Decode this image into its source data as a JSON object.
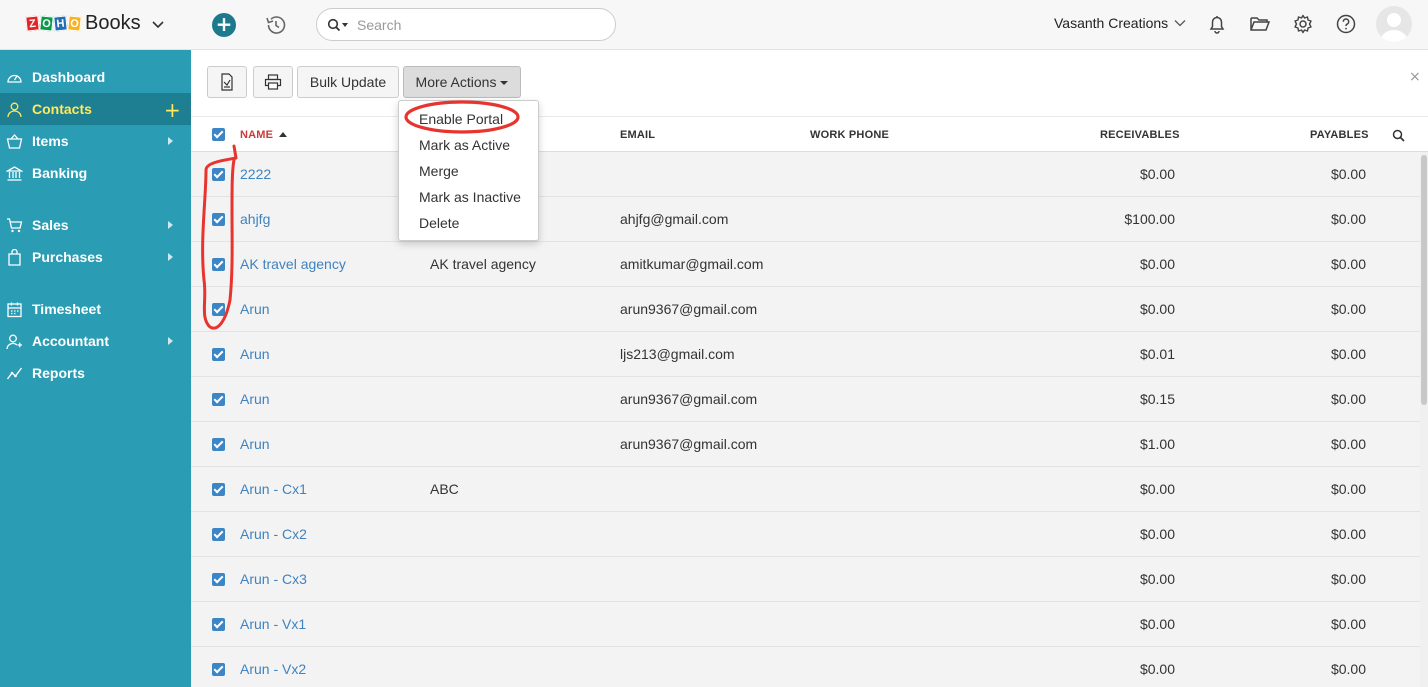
{
  "app": {
    "brand_logo_letters": [
      "Z",
      "O",
      "H",
      "O"
    ],
    "brand_logo_colors": [
      "#e42527",
      "#089949",
      "#226db4",
      "#f9b21d"
    ],
    "brand_name": "Books",
    "search_placeholder": "Search",
    "org_name": "Vasanth Creations"
  },
  "sidebar": {
    "items": [
      {
        "label": "Dashboard",
        "icon": "dashboard-icon"
      },
      {
        "label": "Contacts",
        "icon": "user-icon",
        "active": true
      },
      {
        "label": "Items",
        "icon": "basket-icon"
      },
      {
        "label": "Banking",
        "icon": "bank-icon"
      },
      {
        "label": "Sales",
        "icon": "cart-icon"
      },
      {
        "label": "Purchases",
        "icon": "bag-icon"
      },
      {
        "label": "Timesheet",
        "icon": "calendar-icon"
      },
      {
        "label": "Accountant",
        "icon": "accountant-icon"
      },
      {
        "label": "Reports",
        "icon": "reports-icon"
      }
    ],
    "contacts_add": "+"
  },
  "toolbar": {
    "bulk_update": "Bulk Update",
    "more_actions": "More Actions",
    "close": "×"
  },
  "table": {
    "columns": {
      "name": "NAME",
      "email": "EMAIL",
      "work_phone": "WORK PHONE",
      "receivables": "RECEIVABLES",
      "payables": "PAYABLES"
    },
    "rows": [
      {
        "name": "2222",
        "company": "",
        "email": "",
        "receivables": "$0.00",
        "payables": "$0.00"
      },
      {
        "name": "ahjfg",
        "company": "",
        "email": "ahjfg@gmail.com",
        "receivables": "$100.00",
        "payables": "$0.00"
      },
      {
        "name": "AK travel agency",
        "company": "AK travel agency",
        "email": "amitkumar@gmail.com",
        "receivables": "$0.00",
        "payables": "$0.00"
      },
      {
        "name": "Arun",
        "company": "",
        "email": "arun9367@gmail.com",
        "receivables": "$0.00",
        "payables": "$0.00"
      },
      {
        "name": "Arun",
        "company": "",
        "email": "ljs213@gmail.com",
        "receivables": "$0.01",
        "payables": "$0.00"
      },
      {
        "name": "Arun",
        "company": "",
        "email": "arun9367@gmail.com",
        "receivables": "$0.15",
        "payables": "$0.00"
      },
      {
        "name": "Arun",
        "company": "",
        "email": "arun9367@gmail.com",
        "receivables": "$1.00",
        "payables": "$0.00"
      },
      {
        "name": "Arun - Cx1",
        "company": "ABC",
        "email": "",
        "receivables": "$0.00",
        "payables": "$0.00"
      },
      {
        "name": "Arun - Cx2",
        "company": "",
        "email": "",
        "receivables": "$0.00",
        "payables": "$0.00"
      },
      {
        "name": "Arun - Cx3",
        "company": "",
        "email": "",
        "receivables": "$0.00",
        "payables": "$0.00"
      },
      {
        "name": "Arun - Vx1",
        "company": "",
        "email": "",
        "receivables": "$0.00",
        "payables": "$0.00"
      },
      {
        "name": "Arun - Vx2",
        "company": "",
        "email": "",
        "receivables": "$0.00",
        "payables": "$0.00"
      }
    ]
  },
  "more_actions_menu": {
    "items": [
      "Enable Portal",
      "Mark as Active",
      "Merge",
      "Mark as Inactive",
      "Delete"
    ]
  },
  "colors": {
    "sidebar": "#2a9cb3",
    "sidebar_active": "#1f7f92",
    "active_label": "#ffe95c",
    "link": "#3f82bf",
    "annotation": "#e8342e",
    "checkbox": "#3d86c6"
  }
}
